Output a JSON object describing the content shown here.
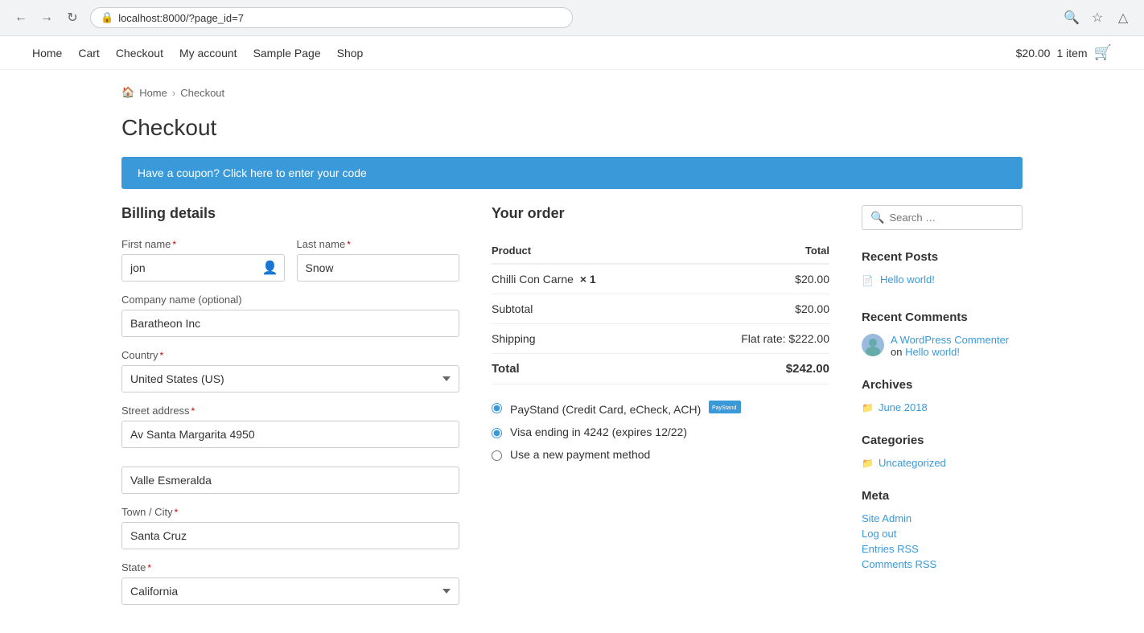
{
  "browser": {
    "url": "localhost:8000/?page_id=7"
  },
  "site_nav": {
    "items": [
      "Home",
      "Cart",
      "Checkout",
      "My account",
      "Sample Page",
      "Shop"
    ],
    "cart_total": "$20.00",
    "cart_items": "1 item"
  },
  "breadcrumb": {
    "home": "Home",
    "current": "Checkout"
  },
  "page_title": "Checkout",
  "coupon_banner": "Have a coupon? Click here to enter your code",
  "billing": {
    "title": "Billing details",
    "first_name_label": "First name",
    "last_name_label": "Last name",
    "company_label": "Company name (optional)",
    "country_label": "Country",
    "street_label": "Street address",
    "town_label": "Town / City",
    "state_label": "State",
    "first_name_value": "jon",
    "last_name_value": "Snow",
    "company_value": "Baratheon Inc",
    "country_value": "United States (US)",
    "street_value1": "Av Santa Margarita 4950",
    "street_value2": "Valle Esmeralda",
    "town_value": "Santa Cruz",
    "state_value": "California"
  },
  "order": {
    "title": "Your order",
    "product_header": "Product",
    "total_header": "Total",
    "item_name": "Chilli Con Carne",
    "item_qty": "× 1",
    "item_total": "$20.00",
    "subtotal_label": "Subtotal",
    "subtotal_value": "$20.00",
    "shipping_label": "Shipping",
    "shipping_value": "Flat rate: $222.00",
    "total_label": "Total",
    "total_value": "$242.00"
  },
  "payment": {
    "paystand_label": "PayStand (Credit Card, eCheck, ACH)",
    "visa_label": "Visa ending in 4242 (expires 12/22)",
    "new_method_label": "Use a new payment method"
  },
  "sidebar": {
    "search_placeholder": "Search …",
    "recent_posts_title": "Recent Posts",
    "recent_posts": [
      {
        "title": "Hello world!"
      }
    ],
    "recent_comments_title": "Recent Comments",
    "recent_comments": [
      {
        "author": "A WordPress Commenter",
        "text": " on ",
        "post": "Hello world!"
      }
    ],
    "archives_title": "Archives",
    "archives": [
      {
        "label": "June 2018"
      }
    ],
    "categories_title": "Categories",
    "categories": [
      {
        "label": "Uncategorized"
      }
    ],
    "meta_title": "Meta",
    "meta": [
      {
        "label": "Site Admin"
      },
      {
        "label": "Log out"
      },
      {
        "label": "Entries RSS"
      },
      {
        "label": "Comments RSS"
      }
    ]
  }
}
